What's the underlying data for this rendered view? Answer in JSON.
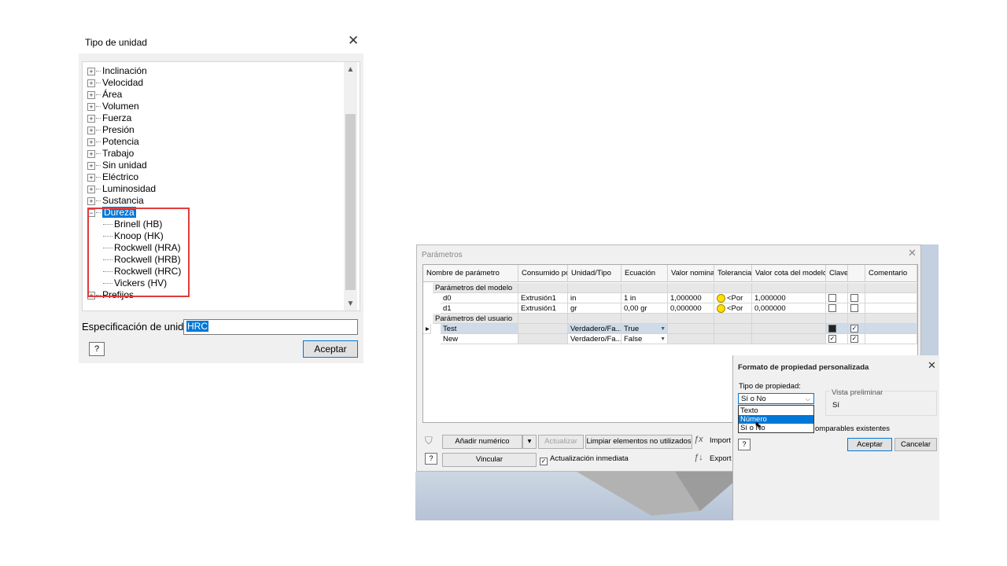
{
  "unit_dialog": {
    "title": "Tipo de unidad",
    "close_glyph": "✕",
    "tree": [
      {
        "label": "Inclinación",
        "expanded": false
      },
      {
        "label": "Velocidad",
        "expanded": false
      },
      {
        "label": "Área",
        "expanded": false
      },
      {
        "label": "Volumen",
        "expanded": false
      },
      {
        "label": "Fuerza",
        "expanded": false
      },
      {
        "label": "Presión",
        "expanded": false
      },
      {
        "label": "Potencia",
        "expanded": false
      },
      {
        "label": "Trabajo",
        "expanded": false
      },
      {
        "label": "Sin unidad",
        "expanded": false
      },
      {
        "label": "Eléctrico",
        "expanded": false
      },
      {
        "label": "Luminosidad",
        "expanded": false
      },
      {
        "label": "Sustancia",
        "expanded": false
      },
      {
        "label": "Dureza",
        "expanded": true,
        "children": [
          "Brinell (HB)",
          "Knoop (HK)",
          "Rockwell (HRA)",
          "Rockwell (HRB)",
          "Rockwell (HRC)",
          "Vickers (HV)"
        ]
      },
      {
        "label": "Prefijos",
        "expanded": false
      }
    ],
    "spec_label": "Especificación de unidad",
    "spec_value": "HRC",
    "help_label": "?",
    "ok_label": "Aceptar",
    "highlight_color": "#e03c3c"
  },
  "params_dialog": {
    "title": "Parámetros",
    "close_glyph": "✕",
    "columns": [
      "Nombre de parámetro",
      "Consumido por",
      "Unidad/Tipo",
      "Ecuación",
      "Valor nominal",
      "Tolerancia",
      "Valor cota del modelo",
      "Clave",
      "",
      "Comentario"
    ],
    "groups": {
      "model": "Parámetros del modelo",
      "user": "Parámetros del usuario"
    },
    "model_rows": [
      {
        "name": "d0",
        "consumed": "Extrusión1",
        "unit": "in",
        "equation": "1 in",
        "nominal": "1,000000",
        "tolerance": "<Por",
        "model_value": "1,000000"
      },
      {
        "name": "d1",
        "consumed": "Extrusión1",
        "unit": "gr",
        "equation": "0,00 gr",
        "nominal": "0,000000",
        "tolerance": "<Por",
        "model_value": "0,000000"
      }
    ],
    "user_rows": [
      {
        "name": "Test",
        "unit": "Verdadero/Fa...",
        "equation": "True"
      },
      {
        "name": "New",
        "unit": "Verdadero/Fa...",
        "equation": "False"
      }
    ],
    "toolbar": {
      "add_numeric": "Añadir numérico",
      "update": "Actualizar",
      "purge": "Limpiar elementos no utilizados",
      "import": "Import",
      "link": "Vincular",
      "immediate_update": "Actualización inmediata",
      "export": "Export",
      "help": "?"
    }
  },
  "format_dialog": {
    "title": "Formato de propiedad personalizada",
    "close_glyph": "✕",
    "type_label": "Tipo de propiedad:",
    "selected_type": "Sí o No",
    "options": [
      "Texto",
      "Número",
      "Sí o No"
    ],
    "preview_label": "Vista preliminar",
    "preview_value": "Sí",
    "existing_text": "omparables existentes",
    "help": "?",
    "ok_label": "Aceptar",
    "cancel_label": "Cancelar"
  }
}
